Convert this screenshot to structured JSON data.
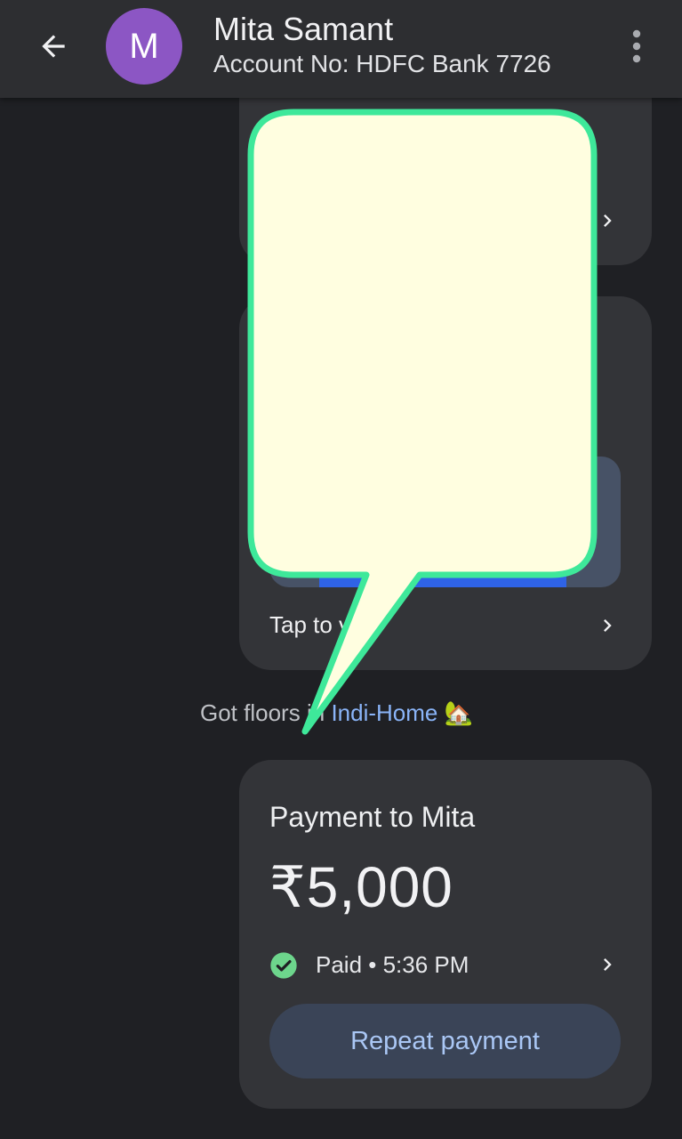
{
  "header": {
    "avatar_letter": "M",
    "contact_name": "Mita Samant",
    "account_line": "Account No: HDFC Bank 7726",
    "back_icon": "arrow-left-icon",
    "menu_icon": "more-vertical-icon"
  },
  "promo_card": {
    "visible_text": "Tap to v"
  },
  "message": {
    "prefix": "Got floors",
    "hidden_fragment": "in",
    "link_text": "Indi-Home",
    "emoji": "🏡"
  },
  "payment_card": {
    "title": "Payment to Mita",
    "amount": "₹5,000",
    "status": "Paid • 5:36 PM",
    "status_icon": "check-circle-icon",
    "repeat_label": "Repeat payment"
  },
  "annotation": {
    "bubble_fill": "#fffee0",
    "bubble_stroke": "#3ee89a"
  },
  "colors": {
    "background": "#1f2024",
    "card": "#333438",
    "accent_link": "#8ab4f8",
    "paid_green": "#6dd58c",
    "avatar": "#8c56c4"
  }
}
